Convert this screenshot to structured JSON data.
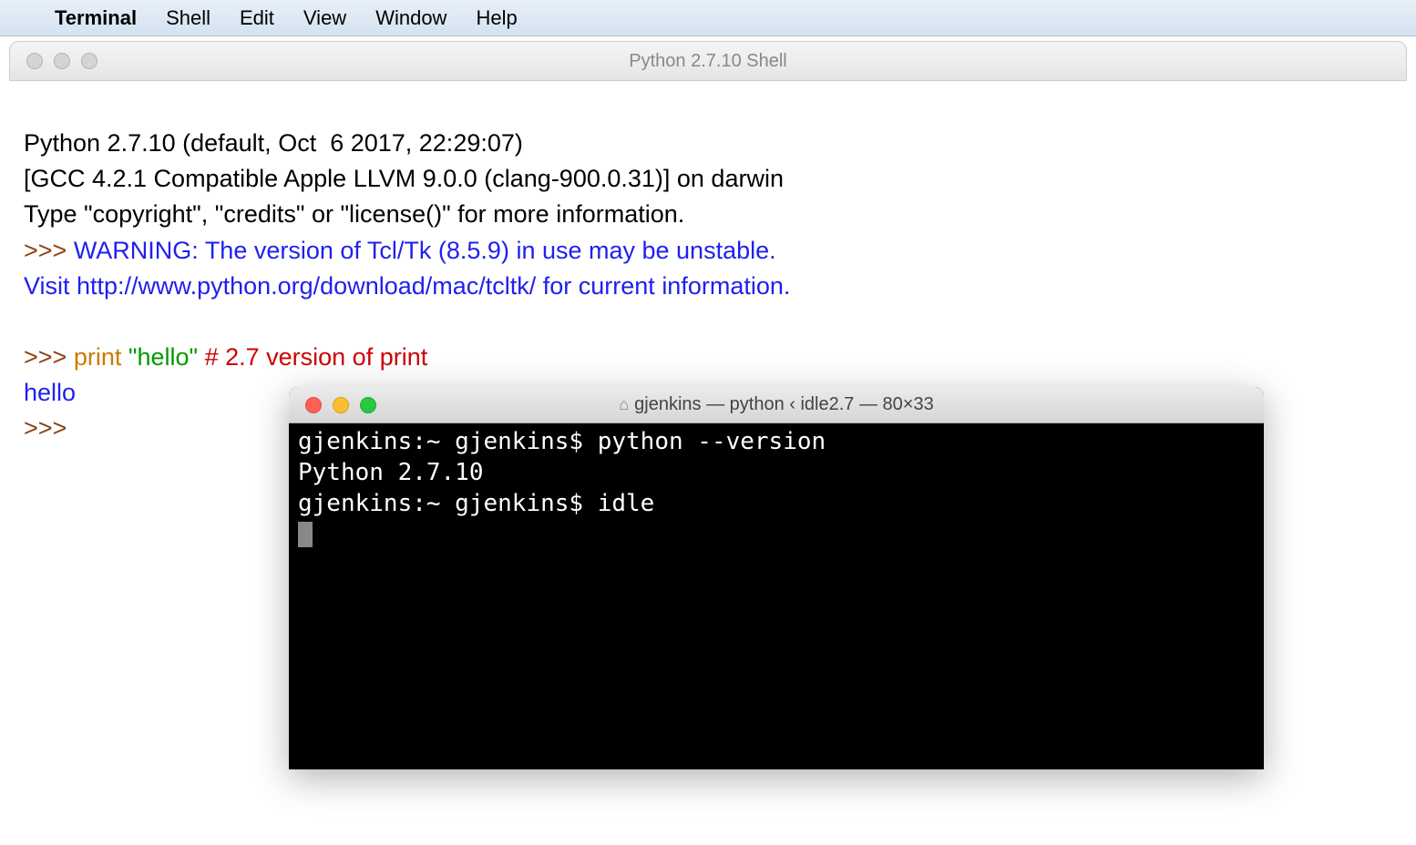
{
  "menubar": {
    "app_name": "Terminal",
    "items": [
      "Shell",
      "Edit",
      "View",
      "Window",
      "Help"
    ]
  },
  "idle": {
    "title": "Python 2.7.10 Shell",
    "lines": {
      "l1": "Python 2.7.10 (default, Oct  6 2017, 22:29:07)",
      "l2": "[GCC 4.2.1 Compatible Apple LLVM 9.0.0 (clang-900.0.31)] on darwin",
      "l3": "Type \"copyright\", \"credits\" or \"license()\" for more information.",
      "prompt1": ">>> ",
      "warn1": "WARNING: The version of Tcl/Tk (8.5.9) in use may be unstable.",
      "warn2": "Visit http://www.python.org/download/mac/tcltk/ for current information.",
      "prompt2": ">>> ",
      "kw_print": "print",
      "space": " ",
      "str_hello": "\"hello\"",
      "comment": " # 2.7 version of print",
      "out_hello": "hello",
      "prompt3": ">>> "
    }
  },
  "terminal": {
    "title": "gjenkins — python ‹ idle2.7 — 80×33",
    "lines": {
      "p1": "gjenkins:~ gjenkins$ python --version",
      "p2": "Python 2.7.10",
      "p3": "gjenkins:~ gjenkins$ idle"
    }
  }
}
